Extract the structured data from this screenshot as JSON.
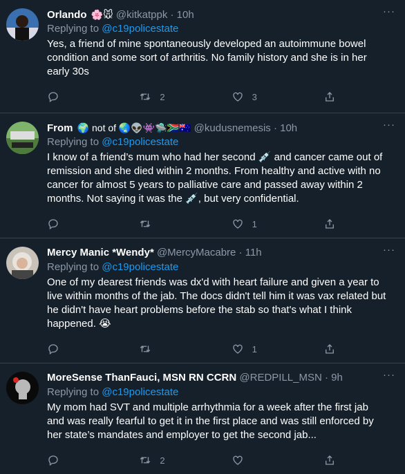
{
  "tweets": [
    {
      "name": "Orlando",
      "emojis": "🌸🐭",
      "handle": "@kitkatppk",
      "time": "10h",
      "replying_label": "Replying to",
      "replying_to": "@c19policestate",
      "text": "Yes, a friend of mine spontaneously developed an autoimmune bowel condition and some sort of arthritis. No family history and she is in her early 30s",
      "reply_count": "",
      "retweet_count": "2",
      "like_count": "3"
    },
    {
      "name": "From",
      "emojis": "🌍 not of 🌏👽👾🛸🇿🇦🇦🇺",
      "handle": "@kudusnemesis",
      "time": "10h",
      "replying_label": "Replying to",
      "replying_to": "@c19policestate",
      "text": "I know of a friend’s mum who had her second 💉 and cancer came out of remission and she died within 2 months. From healthy and active with no cancer for almost 5 years to palliative care and passed away within 2 months. Not saying it was the 💉, but very confidential.",
      "reply_count": "",
      "retweet_count": "",
      "like_count": "1"
    },
    {
      "name": "Mercy Manic *Wendy*",
      "emojis": "",
      "handle": "@MercyMacabre",
      "time": "11h",
      "replying_label": "Replying to",
      "replying_to": "@c19policestate",
      "text": "One of my dearest friends was dx'd with heart failure and given a year to live within months of the jab. The docs didn't tell him it was vax related but he didn't have heart problems before the stab so that's what I think happened. 😭",
      "reply_count": "",
      "retweet_count": "",
      "like_count": "1"
    },
    {
      "name": "MoreSense ThanFauci, MSN RN CCRN",
      "emojis": "",
      "handle": "@REDPILL_MSN",
      "time": "9h",
      "replying_label": "Replying to",
      "replying_to": "@c19policestate",
      "text": "My mom had SVT and multiple arrhythmia for a week after the first jab and was really fearful to get it in the first place and was still enforced by her state’s mandates and employer to get the second jab...",
      "reply_count": "",
      "retweet_count": "2",
      "like_count": ""
    }
  ],
  "dot": "·",
  "more_label": "···"
}
